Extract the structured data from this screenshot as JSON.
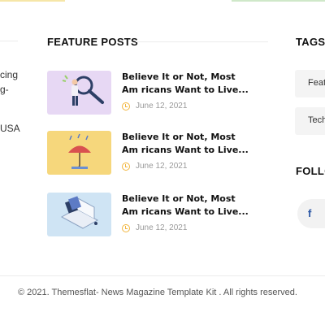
{
  "left_column": {
    "text_line1": "cing",
    "text_line2": "g-",
    "text_line3": "USA"
  },
  "feature_posts": {
    "title": "FEATURE POSTS",
    "posts": [
      {
        "title": "Believe It or Not, Most Am ricans Want to Live...",
        "date": "June 12, 2021",
        "thumb": "person-with-magnifier",
        "bg": "#e7d8f4"
      },
      {
        "title": "Believe It or Not, Most Am ricans Want to Live...",
        "date": "June 12, 2021",
        "thumb": "umbrella-rain",
        "bg": "#f6d77c"
      },
      {
        "title": "Believe It or Not, Most Am ricans Want to Live...",
        "date": "June 12, 2021",
        "thumb": "laptop-cards",
        "bg": "#cfe4f4"
      }
    ]
  },
  "tags": {
    "title": "TAGS",
    "items": [
      "Feat",
      "Tech"
    ]
  },
  "follow": {
    "title": "FOLLO",
    "icons": [
      "facebook-icon"
    ]
  },
  "footer": {
    "text": "© 2021. Themesflat- News Magazine Template Kit . All rights reserved."
  },
  "colors": {
    "accent": "#f2b53c",
    "facebook": "#2b57a5"
  }
}
